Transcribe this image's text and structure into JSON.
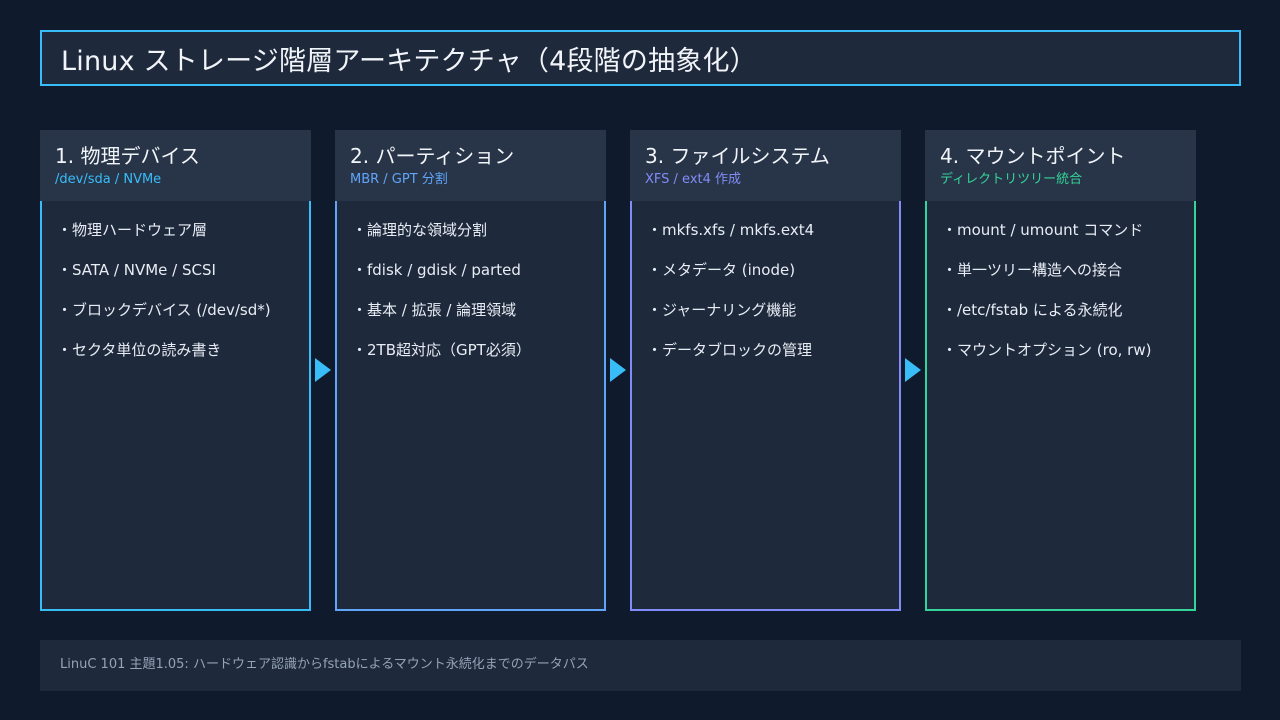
{
  "title": "Linux ストレージ階層アーキテクチャ（4段階の抽象化）",
  "colors": {
    "background": "#0f1a2d",
    "panel": "#1e293b",
    "col1_accent": "#38bdf8",
    "col2_accent": "#60a5fa",
    "col3_accent": "#818cf8",
    "col4_accent": "#34d399"
  },
  "columns": [
    {
      "title": "1. 物理デバイス",
      "subtitle": "/dev/sda / NVMe",
      "items": [
        "・物理ハードウェア層",
        "・SATA / NVMe / SCSI",
        "・ブロックデバイス (/dev/sd*)",
        "・セクタ単位の読み書き"
      ]
    },
    {
      "title": "2. パーティション",
      "subtitle": "MBR / GPT 分割",
      "items": [
        "・論理的な領域分割",
        "・fdisk / gdisk / parted",
        "・基本 / 拡張 / 論理領域",
        "・2TB超対応（GPT必須）"
      ]
    },
    {
      "title": "3. ファイルシステム",
      "subtitle": "XFS / ext4 作成",
      "items": [
        "・mkfs.xfs / mkfs.ext4",
        "・メタデータ (inode)",
        "・ジャーナリング機能",
        "・データブロックの管理"
      ]
    },
    {
      "title": "4. マウントポイント",
      "subtitle": "ディレクトリツリー統合",
      "items": [
        "・mount / umount コマンド",
        "・単一ツリー構造への接合",
        "・/etc/fstab による永続化",
        "・マウントオプション (ro, rw)"
      ]
    }
  ],
  "footer": "LinuC 101 主題1.05: ハードウェア認識からfstabによるマウント永続化までのデータパス"
}
